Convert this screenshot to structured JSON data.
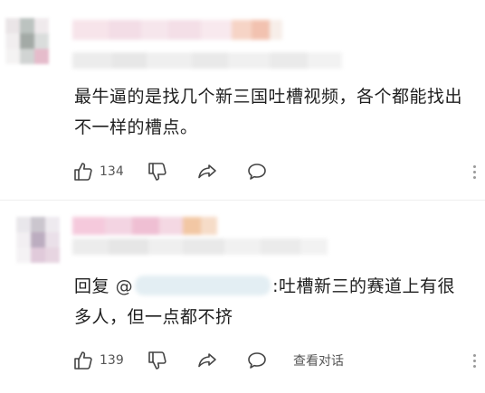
{
  "comments": [
    {
      "text": "最牛逼的是找几个新三国吐槽视频，各个都能找出不一样的槽点。",
      "likes": "134",
      "icons": [
        "thumb-up-icon",
        "thumb-down-icon",
        "share-icon",
        "comment-icon",
        "more-vertical-icon"
      ]
    },
    {
      "reply_prefix": "回复",
      "mention_symbol": "@",
      "text": ":吐槽新三的赛道上有很多人，但一点都不挤",
      "likes": "139",
      "view_thread_label": "查看对话",
      "icons": [
        "thumb-up-icon",
        "thumb-down-icon",
        "share-icon",
        "comment-icon",
        "more-vertical-icon"
      ]
    }
  ],
  "colors": {
    "text": "#1f1f1f",
    "meta": "#555555",
    "icon": "#444444",
    "divider": "#eeeeee"
  }
}
